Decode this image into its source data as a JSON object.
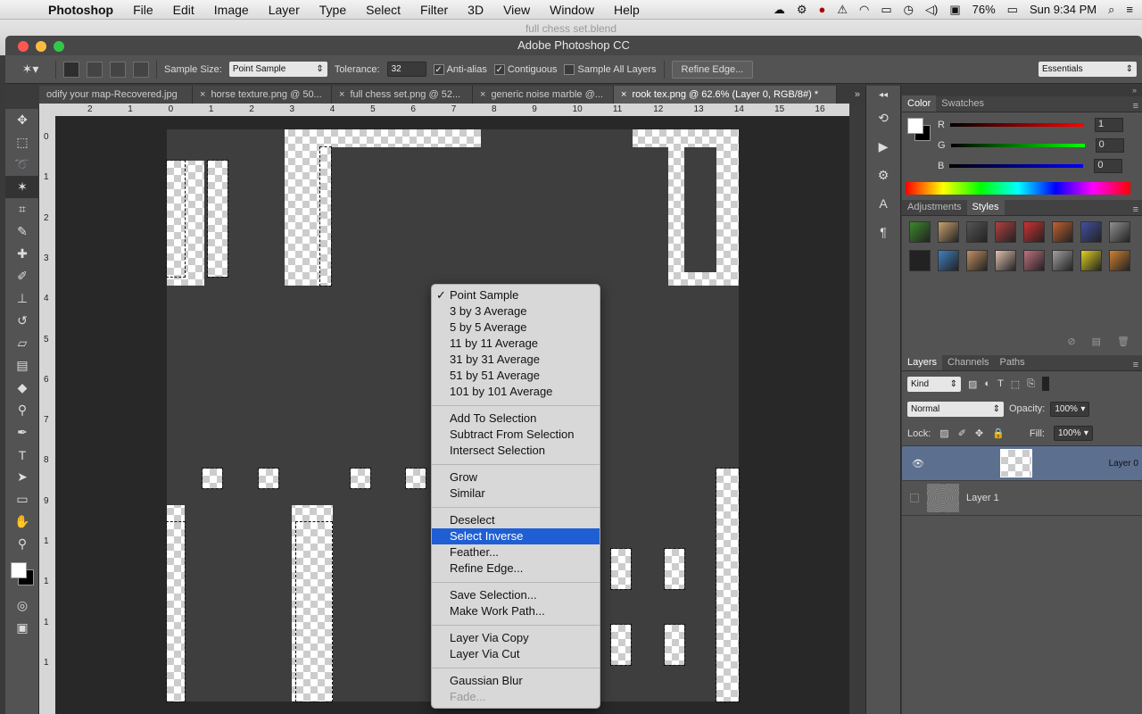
{
  "menubar": {
    "app": "Photoshop",
    "items": [
      "File",
      "Edit",
      "Image",
      "Layer",
      "Type",
      "Select",
      "Filter",
      "3D",
      "View",
      "Window",
      "Help"
    ],
    "battery": "76%",
    "clock": "Sun 9:34 PM"
  },
  "window": {
    "background_title": "full chess set.blend",
    "title": "Adobe Photoshop CC"
  },
  "options": {
    "sample_size_label": "Sample Size:",
    "sample_size_value": "Point Sample",
    "tolerance_label": "Tolerance:",
    "tolerance_value": "32",
    "antialias_label": "Anti-alias",
    "contiguous_label": "Contiguous",
    "sample_all_label": "Sample All Layers",
    "refine_edge": "Refine Edge...",
    "workspace": "Essentials"
  },
  "tabs": [
    {
      "label": "odify your map-Recovered.jpg",
      "active": false
    },
    {
      "label": "horse texture.png @ 50...",
      "active": false
    },
    {
      "label": "full chess set.png @ 52...",
      "active": false
    },
    {
      "label": "generic noise marble @...",
      "active": false
    },
    {
      "label": "rook tex.png @ 62.6% (Layer 0, RGB/8#) *",
      "active": true
    }
  ],
  "ruler_h": [
    "2",
    "1",
    "0",
    "1",
    "2",
    "3",
    "4",
    "5",
    "6",
    "7",
    "8",
    "9",
    "10",
    "11",
    "12",
    "13",
    "14",
    "15",
    "16"
  ],
  "ruler_v": [
    "0",
    "1",
    "2",
    "3",
    "4",
    "5",
    "6",
    "7",
    "8",
    "9",
    "1",
    "1",
    "1",
    "1"
  ],
  "color_panel": {
    "tabs": [
      "Color",
      "Swatches"
    ],
    "r_label": "R",
    "r_value": "1",
    "g_label": "G",
    "g_value": "0",
    "b_label": "B",
    "b_value": "0"
  },
  "styles_panel": {
    "tabs": [
      "Adjustments",
      "Styles"
    ],
    "swatch_colors": [
      "#3a8a2a",
      "#c8a070",
      "#555",
      "#b04040",
      "#d03030",
      "#c06030",
      "#4050a0",
      "#909090",
      "#222",
      "#4080c0",
      "#c09060",
      "#e0c0b0",
      "#c07080",
      "#a0a0a0",
      "#e0d020",
      "#d08030"
    ]
  },
  "layers_panel": {
    "tabs": [
      "Layers",
      "Channels",
      "Paths"
    ],
    "kind": "Kind",
    "blend_mode": "Normal",
    "opacity_label": "Opacity:",
    "opacity_value": "100%",
    "lock_label": "Lock:",
    "fill_label": "Fill:",
    "fill_value": "100%",
    "layers": [
      {
        "name": "Layer 0",
        "visible": true,
        "selected": true
      },
      {
        "name": "Layer 1",
        "visible": false,
        "selected": false
      }
    ]
  },
  "context_menu": {
    "groups": [
      [
        {
          "label": "Point Sample",
          "checked": true
        },
        {
          "label": "3 by 3 Average"
        },
        {
          "label": "5 by 5 Average"
        },
        {
          "label": "11 by 11 Average"
        },
        {
          "label": "31 by 31 Average"
        },
        {
          "label": "51 by 51 Average"
        },
        {
          "label": "101 by 101 Average"
        }
      ],
      [
        {
          "label": "Add To Selection"
        },
        {
          "label": "Subtract From Selection"
        },
        {
          "label": "Intersect Selection"
        }
      ],
      [
        {
          "label": "Grow"
        },
        {
          "label": "Similar"
        }
      ],
      [
        {
          "label": "Deselect"
        },
        {
          "label": "Select Inverse",
          "highlighted": true
        },
        {
          "label": "Feather..."
        },
        {
          "label": "Refine Edge..."
        }
      ],
      [
        {
          "label": "Save Selection..."
        },
        {
          "label": "Make Work Path..."
        }
      ],
      [
        {
          "label": "Layer Via Copy"
        },
        {
          "label": "Layer Via Cut"
        }
      ],
      [
        {
          "label": "Gaussian Blur"
        },
        {
          "label": "Fade...",
          "disabled": true
        }
      ]
    ]
  },
  "colors": {
    "highlight": "#1f5fd3",
    "layer_selected": "#5c6f8f"
  }
}
